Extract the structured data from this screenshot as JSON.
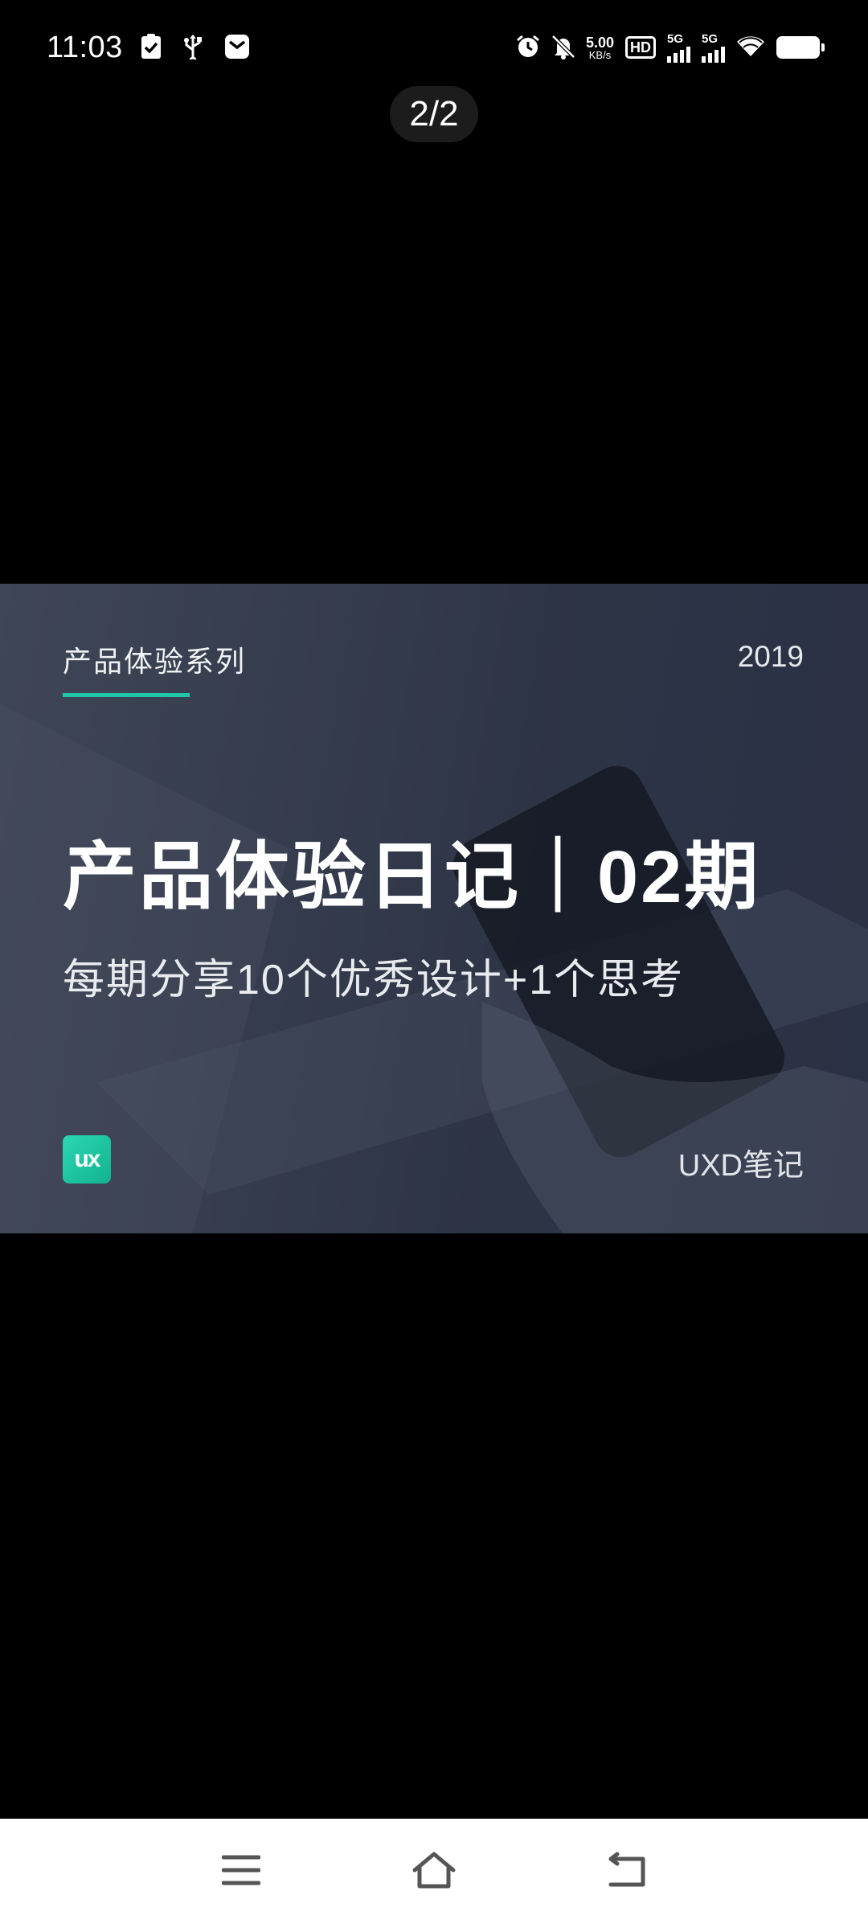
{
  "status_bar": {
    "time": "11:03",
    "net_speed_value": "5.00",
    "net_speed_unit": "KB/s",
    "hd_label": "HD",
    "sim1_label": "5G",
    "sim2_label": "5G",
    "left_icons": [
      "checklist-icon",
      "usb-icon",
      "message-icon"
    ],
    "right_icons": [
      "alarm-icon",
      "mute-icon",
      "wifi-icon",
      "battery-icon"
    ]
  },
  "viewer": {
    "page_counter": "2/2"
  },
  "banner": {
    "series_label": "产品体验系列",
    "year": "2019",
    "title": "产品体验日记｜02期",
    "subtitle": "每期分享10个优秀设计+1个思考",
    "logo_text": "ux",
    "brand_name": "UXD笔记",
    "accent_color": "#1fc7a8"
  },
  "nav_bar": {
    "buttons": [
      "menu-icon",
      "home-icon",
      "back-icon"
    ]
  }
}
